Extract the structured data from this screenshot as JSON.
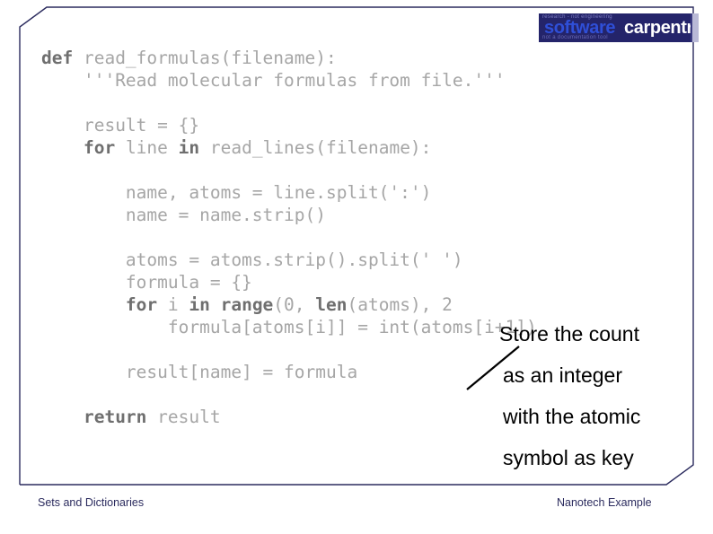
{
  "slide": {
    "border_color": "#2b2b5e",
    "background": "#ffffff"
  },
  "logo": {
    "word1": "software",
    "word2": "carpentry",
    "word1_color": "#2f4fd8",
    "word2_color": "#ffffff",
    "background": "#24246a",
    "ghost_top": "research - not engineering",
    "ghost_bottom": "not a documentation tool"
  },
  "code": {
    "text_color": "#a6a6a6",
    "keyword_color": "#6f6f6f",
    "lines": [
      {
        "type": "code",
        "indent": 0,
        "parts": [
          {
            "t": "def ",
            "kw": true
          },
          {
            "t": "read_formulas(filename):",
            "kw": false
          }
        ]
      },
      {
        "type": "code",
        "indent": 1,
        "parts": [
          {
            "t": "'''Read molecular formulas from file.'''",
            "kw": false
          }
        ]
      },
      {
        "type": "blank"
      },
      {
        "type": "code",
        "indent": 1,
        "parts": [
          {
            "t": "result = {}",
            "kw": false
          }
        ]
      },
      {
        "type": "code",
        "indent": 1,
        "parts": [
          {
            "t": "for ",
            "kw": true
          },
          {
            "t": "line ",
            "kw": false
          },
          {
            "t": "in ",
            "kw": true
          },
          {
            "t": "read_lines(filename):",
            "kw": false
          }
        ]
      },
      {
        "type": "blank"
      },
      {
        "type": "code",
        "indent": 2,
        "parts": [
          {
            "t": "name, atoms = line.split(':')",
            "kw": false
          }
        ]
      },
      {
        "type": "code",
        "indent": 2,
        "parts": [
          {
            "t": "name = name.strip()",
            "kw": false
          }
        ]
      },
      {
        "type": "blank"
      },
      {
        "type": "code",
        "indent": 2,
        "parts": [
          {
            "t": "atoms = atoms.strip().split(' ')",
            "kw": false
          }
        ]
      },
      {
        "type": "code",
        "indent": 2,
        "parts": [
          {
            "t": "formula = {}",
            "kw": false
          }
        ]
      },
      {
        "type": "code",
        "indent": 2,
        "parts": [
          {
            "t": "for ",
            "kw": true
          },
          {
            "t": "i ",
            "kw": false
          },
          {
            "t": "in range",
            "kw": true
          },
          {
            "t": "(0, ",
            "kw": false
          },
          {
            "t": "len",
            "kw": true
          },
          {
            "t": "(atoms), 2",
            "kw": false
          }
        ]
      },
      {
        "type": "code",
        "indent": 3,
        "parts": [
          {
            "t": "formula[atoms[i]] = int(atoms[i+1])",
            "kw": false
          }
        ]
      },
      {
        "type": "blank"
      },
      {
        "type": "code",
        "indent": 2,
        "parts": [
          {
            "t": "result[name] = formula",
            "kw": false
          }
        ]
      },
      {
        "type": "blank"
      },
      {
        "type": "code",
        "indent": 1,
        "parts": [
          {
            "t": "return ",
            "kw": true
          },
          {
            "t": "result",
            "kw": false
          }
        ]
      }
    ]
  },
  "annotation": {
    "color": "#000000",
    "lines": [
      "Store the count",
      "as an integer",
      "with the atomic",
      "symbol as key"
    ]
  },
  "footer": {
    "left": "Sets and Dictionaries",
    "right": "Nanotech Example"
  }
}
